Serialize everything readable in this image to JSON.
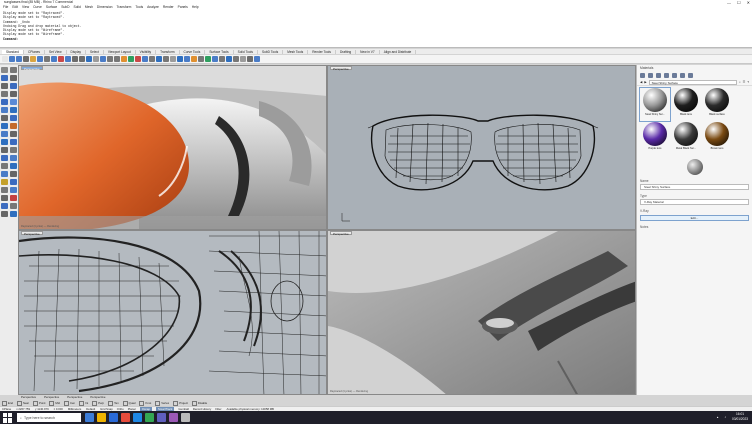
{
  "window": {
    "title": "sunglasses final (85 MB) - Rhino 7 Commercial",
    "controls": [
      "—",
      "☐",
      "✕"
    ]
  },
  "menu": [
    "File",
    "Edit",
    "View",
    "Curve",
    "Surface",
    "SubD",
    "Solid",
    "Mesh",
    "Dimension",
    "Transform",
    "Tools",
    "Analyze",
    "Render",
    "Panels",
    "Help"
  ],
  "command_history": [
    "Display mode set to \"Raytraced\".",
    "Display mode set to \"Raytraced\".",
    "Command: _Undo",
    "Undoing Drag and drop material to object.",
    "Display mode set to \"Wireframe\".",
    "Display mode set to \"Wireframe\"."
  ],
  "command_prompt": "Command:",
  "toolbar_tabs": [
    "Standard",
    "CPlanes",
    "Set View",
    "Display",
    "Select",
    "Viewport Layout",
    "Visibility",
    "Transform",
    "Curve Tools",
    "Surface Tools",
    "Solid Tools",
    "SubD Tools",
    "Mesh Tools",
    "Render Tools",
    "Drafting",
    "New in V7",
    "Align and Distribute"
  ],
  "viewports": {
    "top_left": {
      "label": "Perspective",
      "footer": "Raytraced (Cycles) — Rendering"
    },
    "top_right": {
      "label": "Perspective"
    },
    "bottom_left": {
      "label": "Perspective"
    },
    "bottom_right": {
      "label": "Perspective",
      "footer": "Raytraced (Cycles) — Rendering"
    }
  },
  "viewport_tabs": [
    "Perspective",
    "Perspective",
    "Perspective",
    "Perspective"
  ],
  "panel": {
    "title": "Materials",
    "path": "Steel Shiny Surface",
    "materials": [
      {
        "name": "Steel Shiny Sur...",
        "color": "#9a9a9a"
      },
      {
        "name": "Black lens",
        "color": "#1e1e1e"
      },
      {
        "name": "Black surface",
        "color": "#2b2b2b"
      },
      {
        "name": "Purple lens",
        "color": "#5a2aa8"
      },
      {
        "name": "Metal Black Sur...",
        "color": "#3a3a3a"
      },
      {
        "name": "Brown lens",
        "color": "#7a4a12"
      }
    ],
    "name_section": "Name",
    "name_value": "Steel Shiny Surface",
    "type_section": "Type",
    "type_value": "V-Ray Material",
    "vray_section": "V-Ray",
    "edit_label": "Edit...",
    "notes_section": "Notes"
  },
  "osnaps": [
    "End",
    "Near",
    "Point",
    "Mid",
    "Cen",
    "Int",
    "Perp",
    "Tan",
    "Quad",
    "Knot",
    "Vertex",
    "Project",
    "Disable"
  ],
  "status": {
    "cplane": "CPlane",
    "x": "x 2267.759",
    "y": "y 1140.979",
    "z": "z 0.000",
    "units": "Millimeters",
    "layer": "Default",
    "buttons": [
      "Grid Snap",
      "Ortho",
      "Planar",
      "Osnap",
      "SmartTrack",
      "Gumball",
      "Record History",
      "Filter"
    ],
    "active": [
      "Osnap",
      "SmartTrack"
    ],
    "message": "Available physical memory: 10058 MB"
  },
  "taskbar": {
    "search_placeholder": "Type here to search",
    "icons": [
      "#3d7dd8",
      "#f0b400",
      "#2a6ad8",
      "#e74c3c",
      "#1e88e5",
      "#34a853",
      "#5f5fbf",
      "#9b59b6",
      "#bbbbbb"
    ],
    "time": "16:01",
    "date": "03/01/2023"
  }
}
